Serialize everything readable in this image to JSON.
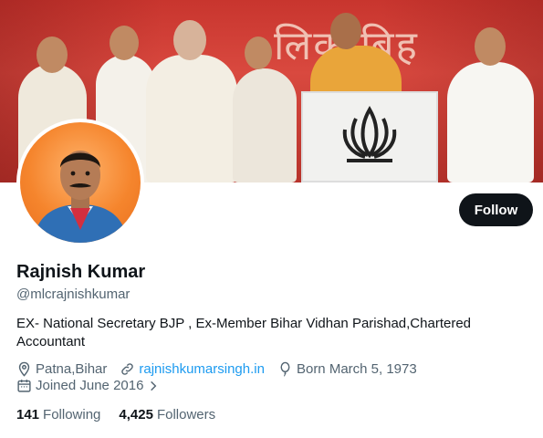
{
  "banner": {
    "sign_text": "लिक बिह"
  },
  "profile": {
    "name": "Rajnish Kumar",
    "handle": "@mlcrajnishkumar",
    "bio": "EX- National Secretary BJP , Ex-Member Bihar Vidhan Parishad,Chartered Accountant",
    "location": "Patna,Bihar",
    "website": "rajnishkumarsingh.in",
    "born": "Born March 5, 1973",
    "joined": "Joined June 2016"
  },
  "actions": {
    "follow_label": "Follow"
  },
  "stats": {
    "following_count": "141",
    "following_label": "Following",
    "followers_count": "4,425",
    "followers_label": "Followers"
  },
  "colors": {
    "link": "#1d9bf0",
    "secondary_text": "#536471",
    "button_bg": "#0f1419"
  },
  "icons": [
    "location-icon",
    "link-icon",
    "balloon-icon",
    "calendar-icon",
    "chevron-right-icon"
  ]
}
